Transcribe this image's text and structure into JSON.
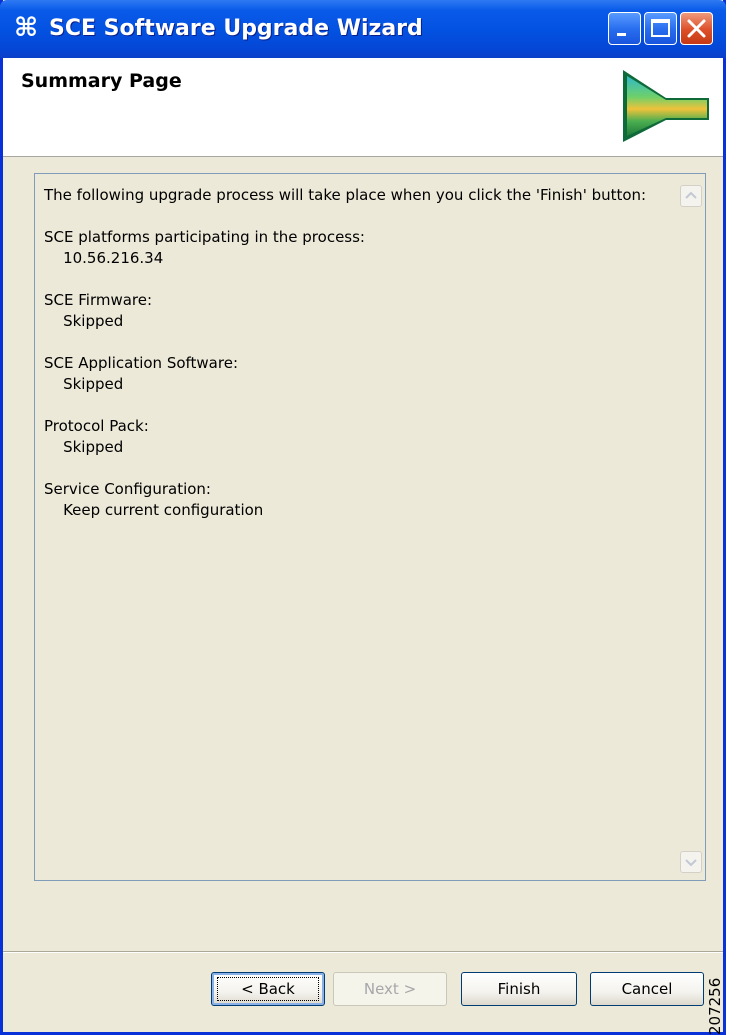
{
  "window": {
    "title": "SCE Software Upgrade Wizard",
    "icon": "cisco-wizard-icon",
    "controls": [
      "minimize-icon",
      "maximize-icon",
      "close-icon"
    ]
  },
  "header": {
    "title": "Summary Page"
  },
  "summary": {
    "intro": "The following upgrade process will take place when you click the 'Finish' button:",
    "sections": [
      {
        "heading": "SCE platforms participating in the process:",
        "value": "10.56.216.34"
      },
      {
        "heading": "SCE Firmware:",
        "value": "Skipped"
      },
      {
        "heading": "SCE Application Software:",
        "value": "Skipped"
      },
      {
        "heading": "Protocol Pack:",
        "value": "Skipped"
      },
      {
        "heading": "Service Configuration:",
        "value": "Keep current configuration"
      }
    ]
  },
  "buttons": {
    "back": "< Back",
    "next": "Next >",
    "finish": "Finish",
    "cancel": "Cancel"
  },
  "figure_number": "207256",
  "colors": {
    "titlebar": "#0351e0",
    "window_bg": "#ece9d8",
    "close_button": "#dc4f28"
  }
}
